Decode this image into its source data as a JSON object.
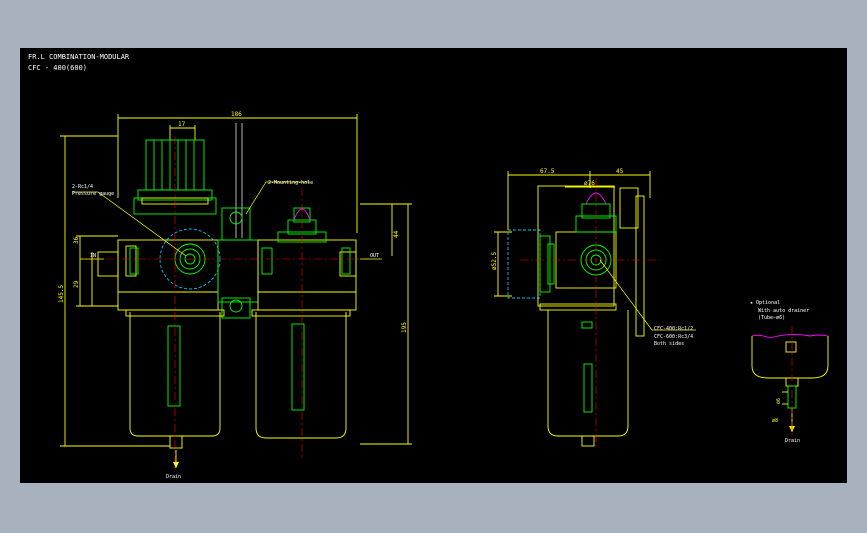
{
  "colors": {
    "background": "#a8b2bf",
    "canvas": "#000000",
    "dimension": "#ffff00",
    "outline": "#ffff00",
    "detail": "#00ff00",
    "centerline": "#ff0000",
    "part": "#ff00ff",
    "hidden": "#00c0ff",
    "text": "#ffffff"
  },
  "title": {
    "line1": "FR.L  COMBINATION-MODULAR",
    "line2": "CFC - 400(600)"
  },
  "front_view": {
    "dims": {
      "overall_width": "186",
      "gauge_width": "17",
      "height_full": "195",
      "height_body": "145.5",
      "dim_36": "36",
      "dim_29": "29",
      "dim_44": "44"
    },
    "labels": {
      "port_note_1": "2-Rc1/4",
      "port_note_2": "Pressure gauge",
      "mount_note": "2-Mounting-hole",
      "in_port": "IN",
      "out_port": "OUT",
      "drain": "Drain"
    }
  },
  "side_view": {
    "dims": {
      "left": "67.5",
      "right": "45",
      "bowl": "ø76",
      "gauge_dia": "ø52.5"
    },
    "labels": {
      "thread_1": "CFC-400:Rc1/2",
      "thread_2": "CFC-600:Rc3/4",
      "thread_3": "Both sides"
    }
  },
  "detail_view": {
    "labels": {
      "note_1": "★ Optional",
      "note_2": "With auto drainer",
      "note_3": "(Tube—ø6)",
      "dim_a": "ö6",
      "dim_b": "ø8",
      "drain": "Drain"
    }
  }
}
